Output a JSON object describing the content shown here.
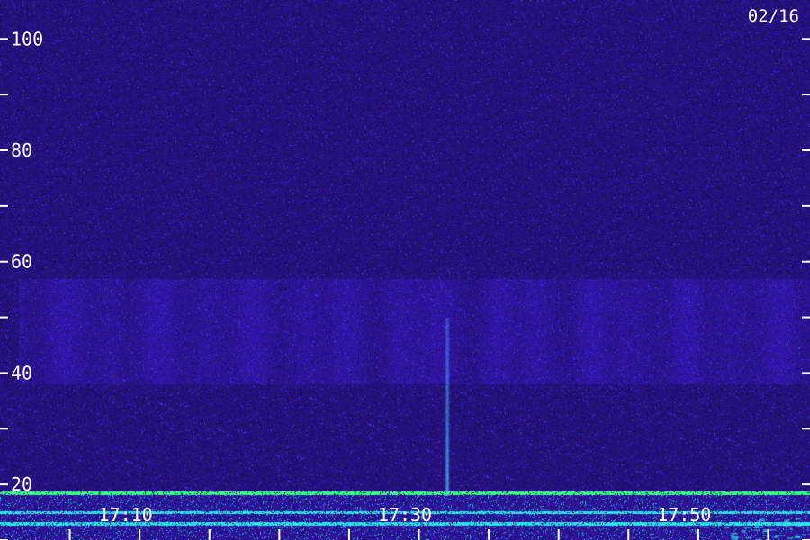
{
  "chart_data": {
    "type": "heatmap",
    "date_label": "02/16",
    "y_axis": {
      "ylim": [
        10,
        107
      ],
      "labeled_ticks": [
        20,
        40,
        60,
        80,
        100
      ],
      "minor_ticks": [
        10,
        30,
        50,
        70,
        90
      ]
    },
    "x_axis": {
      "xlim": [
        "17:01",
        "17:59"
      ],
      "labeled_ticks": [
        "17:10",
        "17:30",
        "17:50"
      ],
      "all_ticks": [
        "17:06",
        "17:11",
        "17:16",
        "17:21",
        "17:26",
        "17:31",
        "17:36",
        "17:41",
        "17:46",
        "17:51",
        "17:56"
      ]
    },
    "colors": {
      "background": "#0a0624",
      "noise_low": "#1a0c5a",
      "noise_mid": "#3a2ad8",
      "band_cyan": "#22d4e8",
      "band_green": "#3cff7a",
      "tick": "#ffffff"
    },
    "features": {
      "diffuse_band": [
        38,
        57
      ],
      "vertical_streak": {
        "time": "17:33",
        "range": [
          18,
          50
        ]
      },
      "bright_lines": [
        13,
        15,
        18.5
      ]
    }
  }
}
